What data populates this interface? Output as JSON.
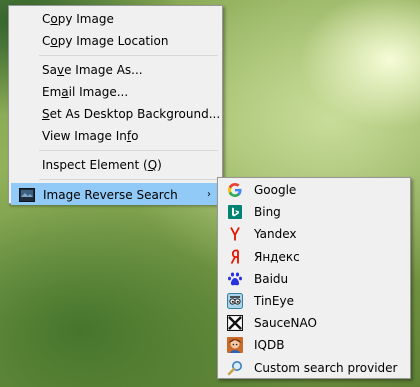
{
  "context_menu": {
    "groups": [
      [
        {
          "pre": "C",
          "u": "o",
          "post": "py Image"
        },
        {
          "pre": "C",
          "u": "o",
          "post": "py Image Location"
        }
      ],
      [
        {
          "pre": "Sa",
          "u": "v",
          "post": "e Image As..."
        },
        {
          "pre": "Em",
          "u": "a",
          "post": "il Image..."
        },
        {
          "pre": "",
          "u": "S",
          "post": "et As Desktop Background..."
        },
        {
          "pre": "View Image In",
          "u": "f",
          "post": "o"
        }
      ],
      [
        {
          "pre": "Inspect Element (",
          "u": "Q",
          "post": ")"
        }
      ]
    ],
    "reverse_search_label": "Image Reverse Search",
    "arrow": "›"
  },
  "submenu": {
    "items": [
      {
        "label": "Google",
        "icon": "google-icon"
      },
      {
        "label": "Bing",
        "icon": "bing-icon"
      },
      {
        "label": "Yandex",
        "icon": "yandex-icon"
      },
      {
        "label": "Яндекс",
        "icon": "yandex-ru-icon"
      },
      {
        "label": "Baidu",
        "icon": "baidu-icon"
      },
      {
        "label": "TinEye",
        "icon": "tineye-icon"
      },
      {
        "label": "SauceNAO",
        "icon": "saucenao-icon"
      },
      {
        "label": "IQDB",
        "icon": "iqdb-icon"
      },
      {
        "label": "Custom search provider",
        "icon": "search-icon"
      }
    ]
  },
  "colors": {
    "menu_bg": "#f0f0f0",
    "highlight": "#91c9f7",
    "google_blue": "#4285f4",
    "bing_teal": "#008373",
    "yandex_red": "#e61400",
    "baidu_blue": "#2932e1"
  }
}
